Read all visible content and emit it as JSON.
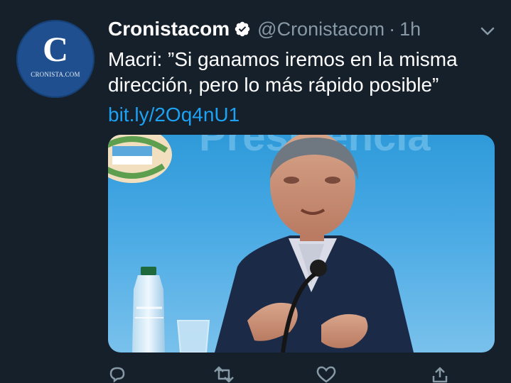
{
  "tweet": {
    "avatar": {
      "letter": "C",
      "wordmark": "CRONISTA.COM"
    },
    "display_name": "Cronistacom",
    "handle": "@Cronistacom",
    "separator": "·",
    "time": "1h",
    "text_lines": [
      "Macri: ”Si ganamos iremos en la misma",
      "dirección, pero lo más rápido posible”"
    ],
    "link": "bit.ly/2Oq4nU1",
    "media": {
      "backdrop_text": "Presidencia"
    }
  },
  "actions": {
    "reply_count": "",
    "retweet_count": "",
    "like_count": ""
  },
  "colors": {
    "background": "#15202b",
    "text": "#ffffff",
    "secondary": "#8899a6",
    "link": "#1da1f2",
    "verified": "#ffffff"
  },
  "icons": {
    "verified": "verified-badge-icon",
    "caret": "chevron-down-icon",
    "reply": "reply-icon",
    "retweet": "retweet-icon",
    "like": "heart-icon",
    "share": "share-icon"
  }
}
